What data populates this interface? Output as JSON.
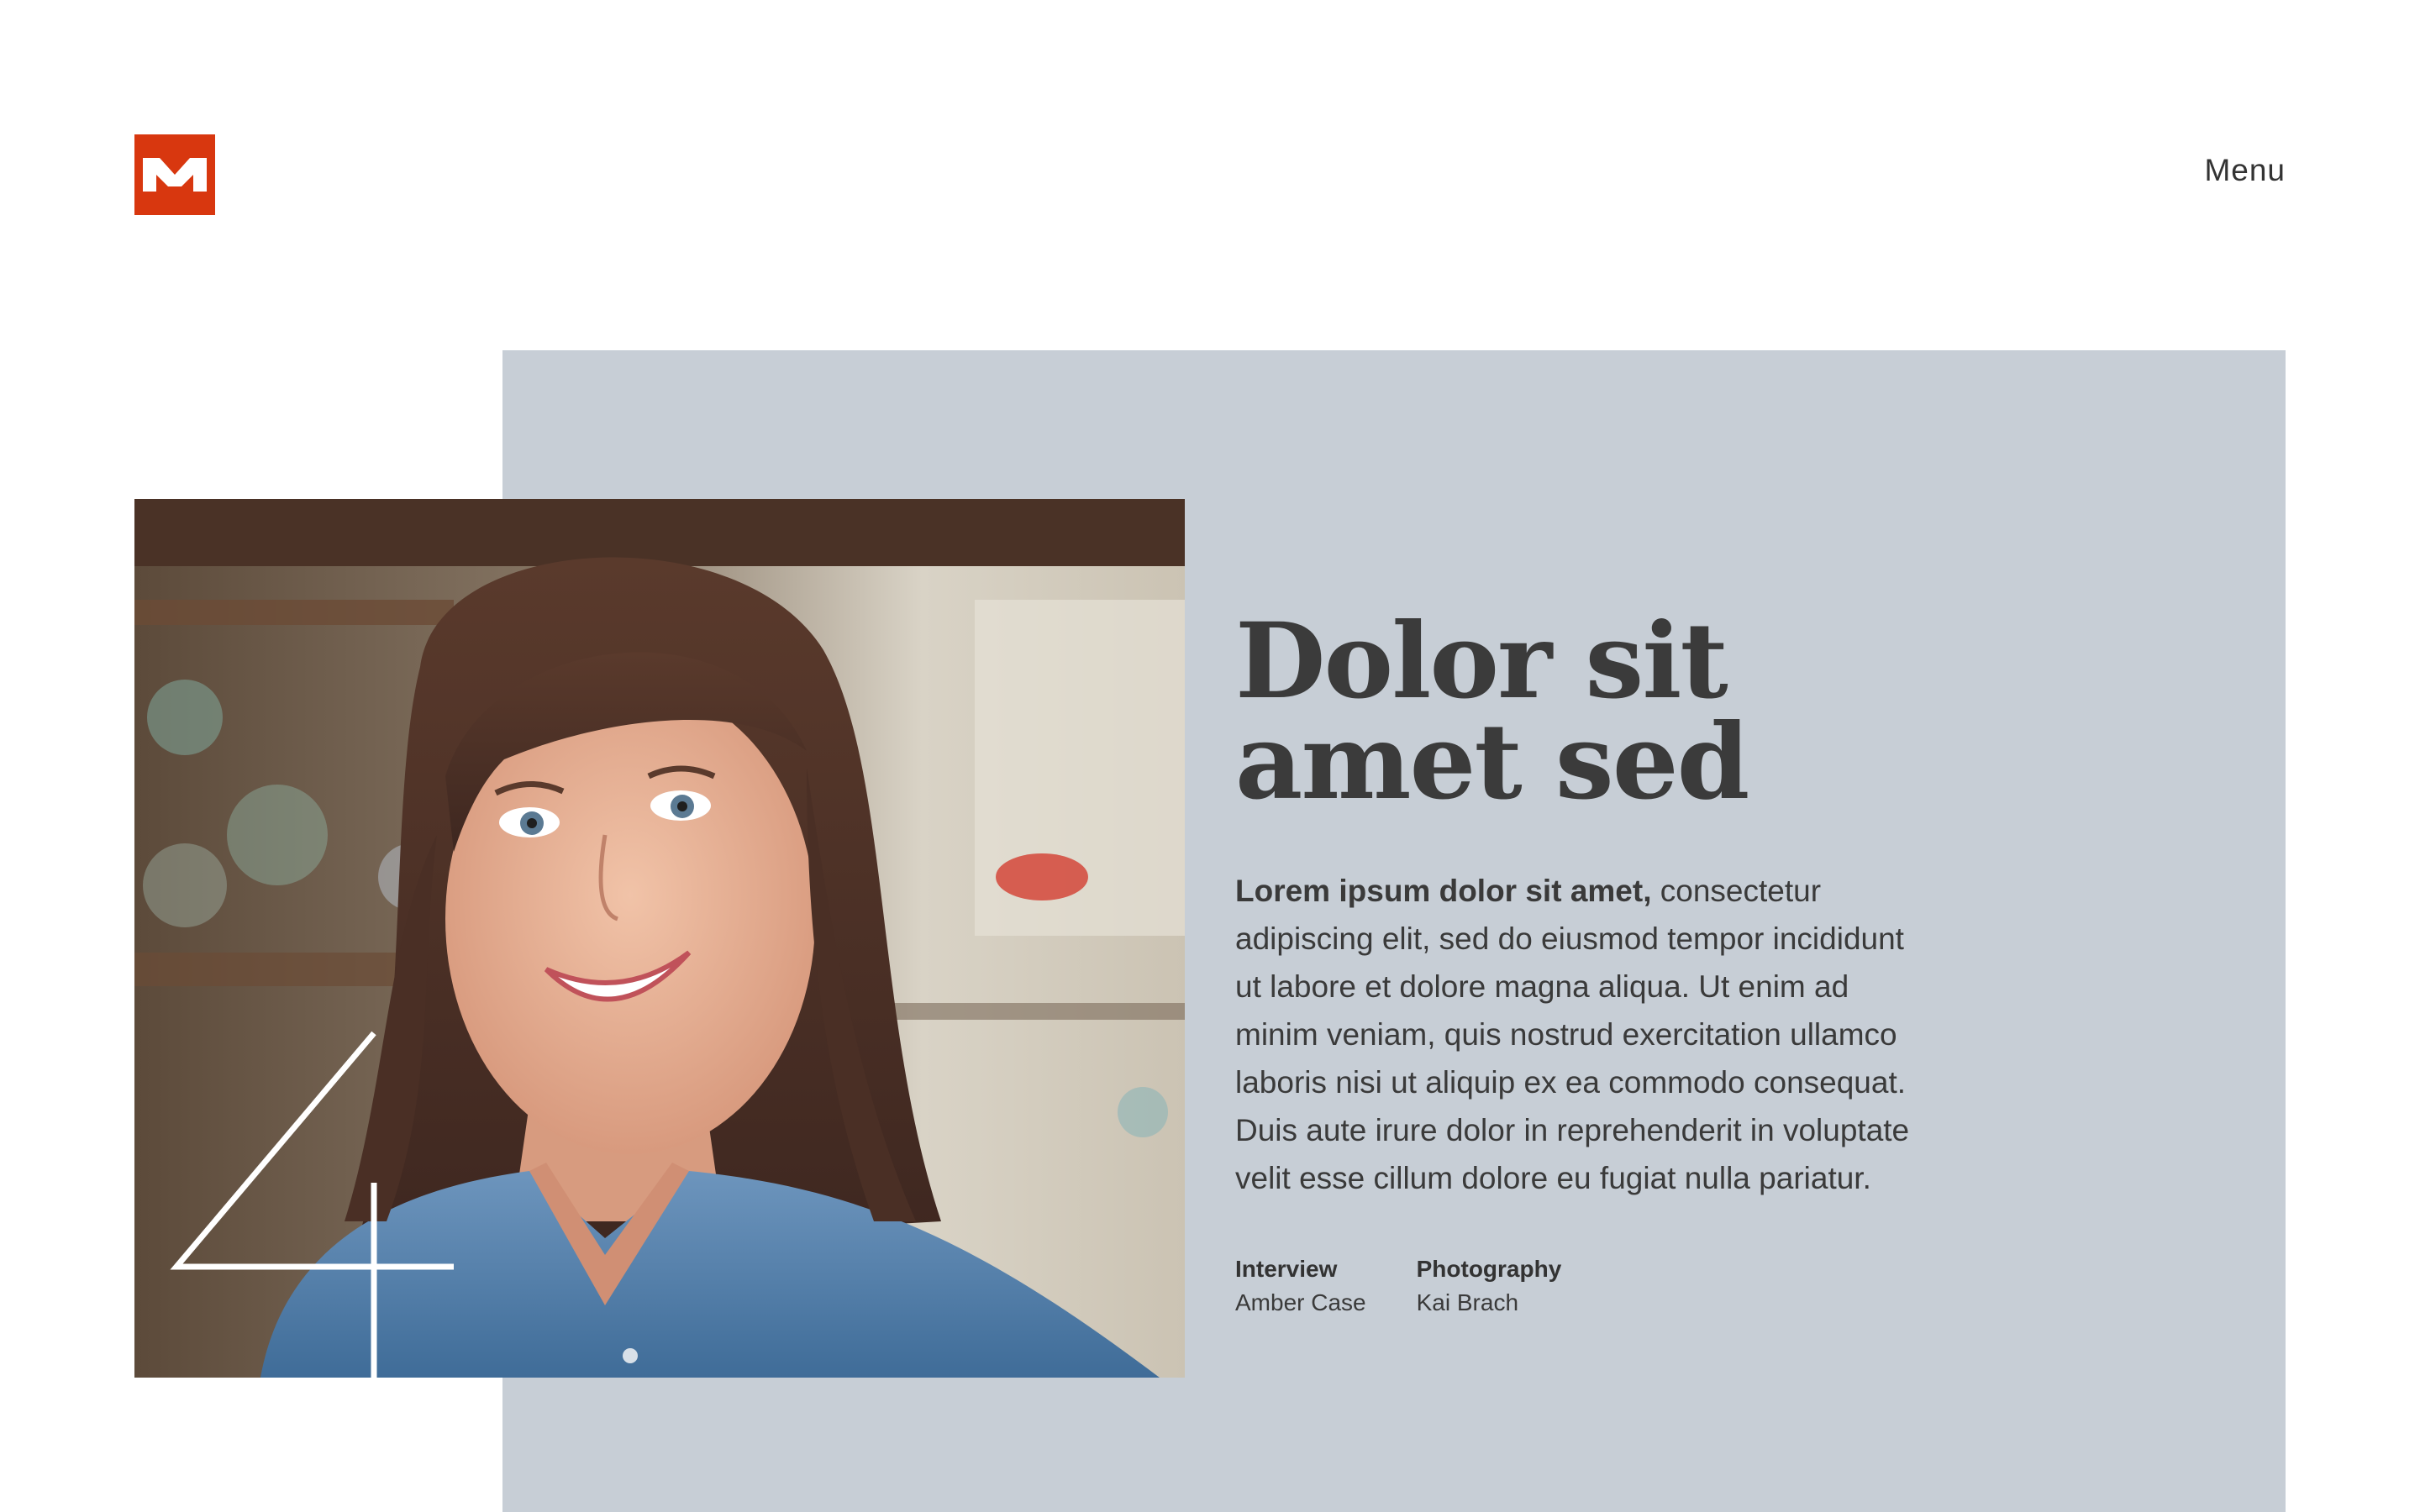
{
  "brand": {
    "logo_letter": "M",
    "logo_color": "#d8370f"
  },
  "nav": {
    "menu_label": "Menu"
  },
  "hero": {
    "panel_color": "#c7ced6",
    "issue_number": "4",
    "headline": "Dolor sit amet sed",
    "lede_bold": "Lorem ipsum dolor sit amet,",
    "lede_rest": " consectetur adipiscing elit, sed do eiusmod tempor incididunt ut labore et dolore magna aliqua. Ut enim ad minim veniam, quis nostrud exercitation ullamco laboris nisi ut aliquip ex ea commodo consequat. Duis aute irure dolor in reprehenderit in voluptate velit esse cillum dolore eu fugiat nulla pariatur.",
    "credits": [
      {
        "label": "Interview",
        "value": "Amber Case"
      },
      {
        "label": "Photography",
        "value": "Kai Brach"
      }
    ]
  }
}
